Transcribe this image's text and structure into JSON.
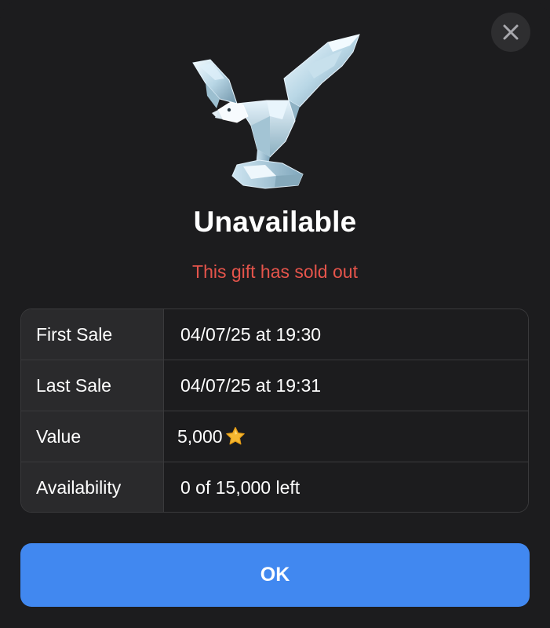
{
  "header": {
    "close_icon": "close-icon",
    "gift_icon": "crystal-eagle-gift"
  },
  "title": "Unavailable",
  "subtitle": "This gift has sold out",
  "details": {
    "first_sale": {
      "label": "First Sale",
      "value": "04/07/25 at 19:30"
    },
    "last_sale": {
      "label": "Last Sale",
      "value": "04/07/25 at 19:31"
    },
    "value": {
      "label": "Value",
      "value": "5,000",
      "icon": "star-icon"
    },
    "availability": {
      "label": "Availability",
      "value": "0 of 15,000 left"
    }
  },
  "ok_button": {
    "label": "OK"
  },
  "colors": {
    "background": "#1c1c1e",
    "accent": "#4188f0",
    "error": "#e5544b",
    "border": "#3a3a3c",
    "label_bg": "#2a2a2c",
    "star": "#f5b731"
  }
}
